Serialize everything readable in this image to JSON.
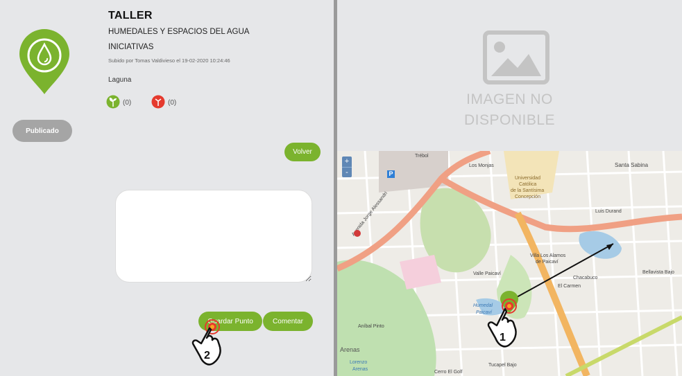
{
  "post": {
    "title": "TALLER",
    "subtitle": "HUMEDALES Y ESPACIOS DEL AGUA",
    "subtitle2": "INICIATIVAS",
    "uploaded_by": "Subido por Tomas Valdivieso el 19-02-2020 10:24:46",
    "category": "Laguna",
    "likes": "(0)",
    "dislikes": "(0)",
    "status": "Publicado"
  },
  "buttons": {
    "back": "Volver",
    "save_point": "Guardar Punto",
    "comment": "Comentar"
  },
  "image": {
    "line1": "IMAGEN NO",
    "line2": "DISPONIBLE"
  },
  "map": {
    "zoom_in": "+",
    "zoom_out": "-",
    "labels": {
      "trebol": "Trébol",
      "monjas": "Los Monjas",
      "univ1": "Universidad",
      "univ2": "Católica",
      "univ3": "de la Santísima",
      "univ4": "Concepción",
      "santa_sabina": "Santa Sabina",
      "luis_durand": "Luis Durand",
      "villa": "Villa Los Alamos",
      "villa2": "de Paicaví",
      "valle": "Valle Paicaví",
      "humedal": "Humedal",
      "paicavi": "Paicaví",
      "chacabuco": "Chacabuco",
      "el_carmen": "El Carmen",
      "arenas": "Arenas",
      "lorenzo": "Lorenzo",
      "arenas2": "Arenas",
      "tucapel": "Tucapel Bajo",
      "cerro": "Cerro El Golf",
      "jorge_alessandri": "Avenida Jorge Alessandri",
      "bellavista": "Bellavista Bajo",
      "anibal": "Aníbal Pinto"
    }
  },
  "annotations": {
    "step1": "1",
    "step2": "2"
  },
  "colors": {
    "accent": "#7bb32e",
    "map_road": "#f0a084",
    "water": "#a6cbe6",
    "dislike": "#e53a2e"
  }
}
